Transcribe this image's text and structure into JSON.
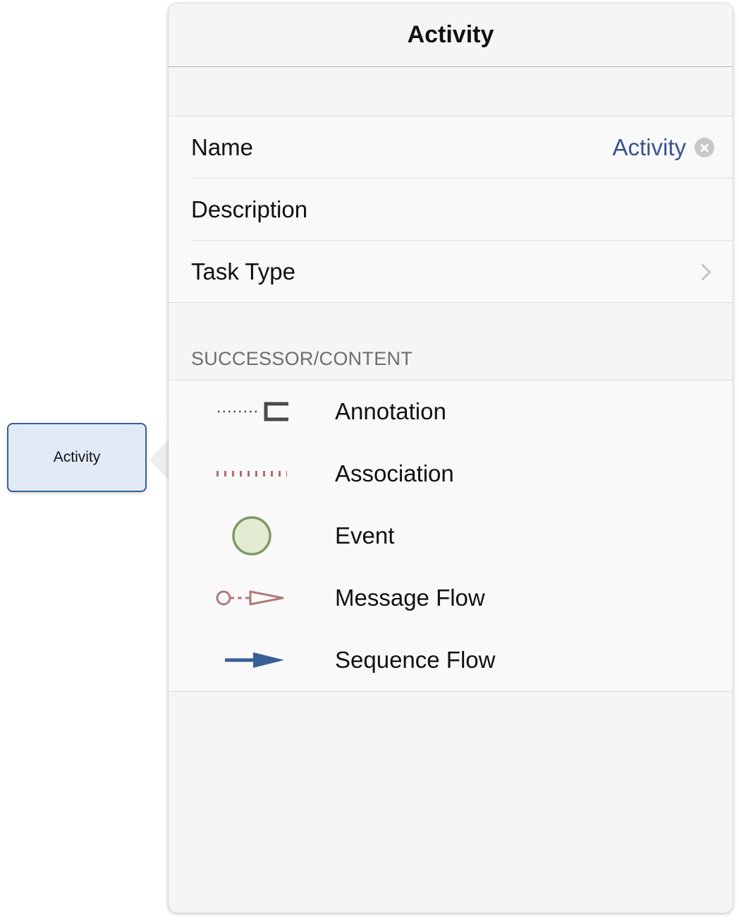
{
  "diagram": {
    "activity_node_label": "Activity"
  },
  "popover": {
    "title": "Activity",
    "rows": {
      "name_label": "Name",
      "name_value": "Activity",
      "description_label": "Description",
      "task_type_label": "Task Type"
    },
    "section_header": "SUCCESSOR/CONTENT",
    "items": [
      {
        "label": "Annotation",
        "icon": "annotation-icon"
      },
      {
        "label": "Association",
        "icon": "association-icon"
      },
      {
        "label": "Event",
        "icon": "event-icon"
      },
      {
        "label": "Message Flow",
        "icon": "message-flow-icon"
      },
      {
        "label": "Sequence Flow",
        "icon": "sequence-flow-icon"
      }
    ]
  },
  "colors": {
    "accent": "#3a5590",
    "activity_fill": "#e1ebf7",
    "activity_border": "#3b5f95",
    "event_fill": "#e3ecd3",
    "event_stroke": "#7e9a66",
    "association_color": "#b86a6e",
    "message_flow_color": "#b07a7c",
    "sequence_flow_color": "#3a5f95"
  }
}
